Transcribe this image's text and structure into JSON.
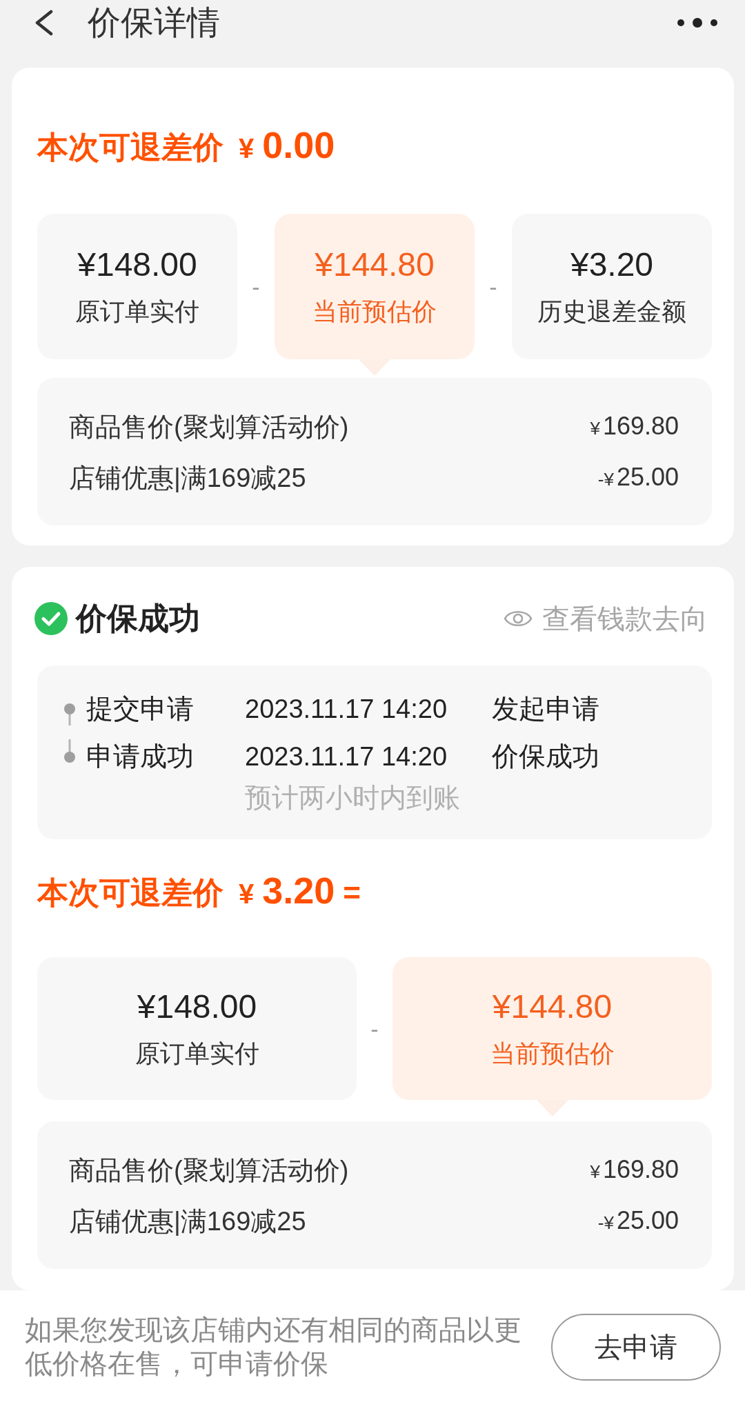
{
  "header": {
    "title": "价保详情"
  },
  "refund_summary": {
    "title": "本次可退差价",
    "amount": "¥0.00",
    "items": [
      {
        "amount": "¥148.00",
        "label": "原订单实付",
        "highlighted": false
      },
      {
        "amount": "¥144.80",
        "label": "当前预估价",
        "highlighted": true
      },
      {
        "amount": "¥3.20",
        "label": "历史退差金额",
        "highlighted": false
      }
    ],
    "operators": [
      "-",
      "-"
    ],
    "details": [
      {
        "label": "商品售价(聚划算活动价)",
        "value": "¥169.80"
      },
      {
        "label": "店铺优惠|满169减25",
        "value": "-¥25.00"
      }
    ]
  },
  "status_card": {
    "status": "价保成功",
    "link": "查看钱款去向",
    "timeline": [
      {
        "step": "提交申请",
        "time": "2023.11.17 14:20",
        "result": "发起申请"
      },
      {
        "step": "申请成功",
        "time": "2023.11.17 14:20",
        "result": "价保成功",
        "note": "预计两小时内到账"
      }
    ],
    "refund": {
      "title": "本次可退差价",
      "amount": "¥3.20",
      "suffix": "=",
      "items": [
        {
          "amount": "¥148.00",
          "label": "原订单实付",
          "highlighted": false
        },
        {
          "amount": "¥144.80",
          "label": "当前预估价",
          "highlighted": true
        }
      ],
      "operators": [
        "-"
      ],
      "details": [
        {
          "label": "商品售价(聚划算活动价)",
          "value": "¥169.80"
        },
        {
          "label": "店铺优惠|满169减25",
          "value": "-¥25.00"
        }
      ]
    }
  },
  "footer": {
    "text": "如果您发现该店铺内还有相同的商品以更低价格在售，可申请价保",
    "button": "去申请"
  }
}
